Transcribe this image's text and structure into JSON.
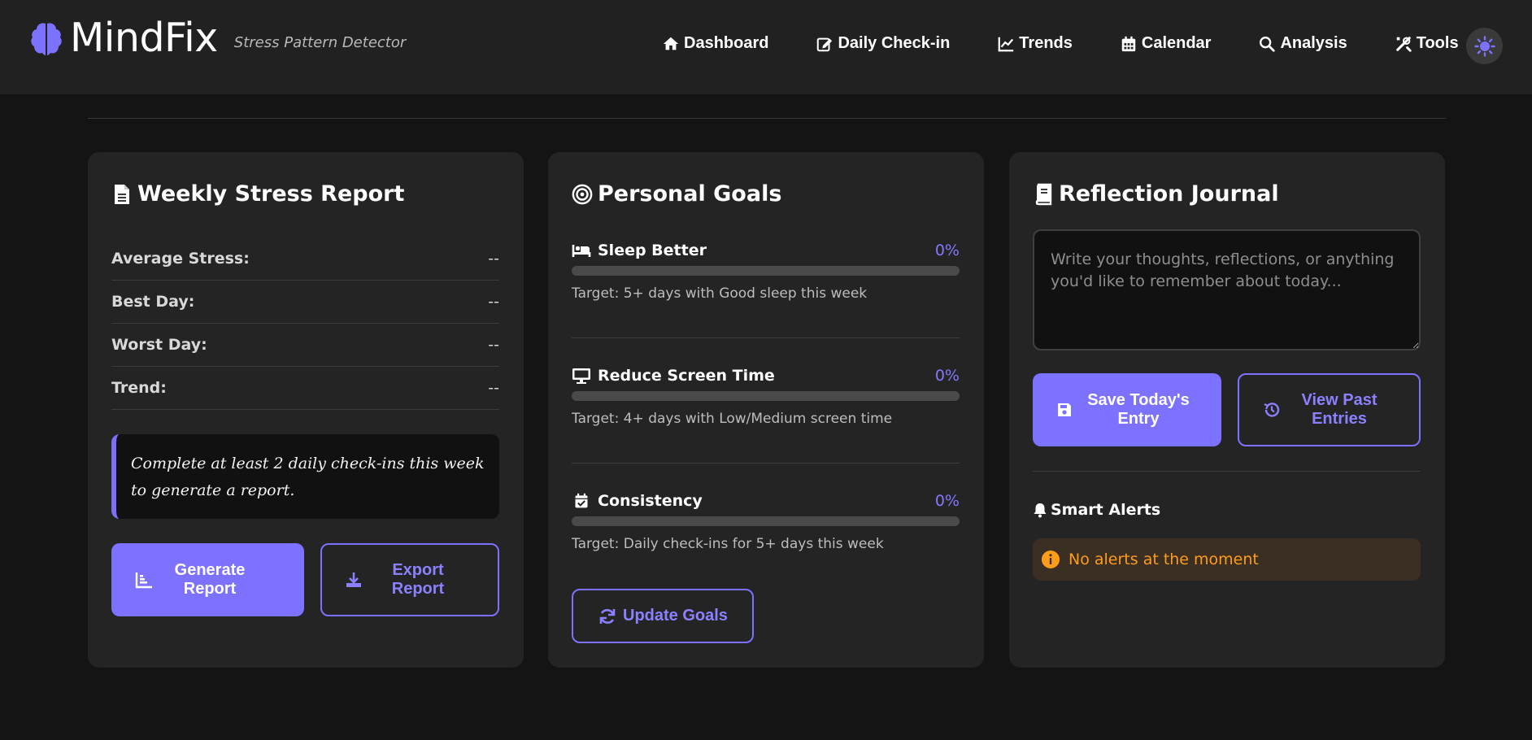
{
  "app": {
    "name": "MindFix",
    "tagline": "Stress Pattern Detector"
  },
  "nav": {
    "items": [
      {
        "label": "Dashboard",
        "icon": "home-icon"
      },
      {
        "label": "Daily Check-in",
        "icon": "edit-icon"
      },
      {
        "label": "Trends",
        "icon": "line-chart-icon"
      },
      {
        "label": "Calendar",
        "icon": "calendar-icon"
      },
      {
        "label": "Analysis",
        "icon": "search-icon"
      },
      {
        "label": "Tools",
        "icon": "tools-icon"
      }
    ],
    "theme_toggle_icon": "sun-icon"
  },
  "weekly_report": {
    "title": "Weekly Stress Report",
    "stats": [
      {
        "label": "Average Stress:",
        "value": "--"
      },
      {
        "label": "Best Day:",
        "value": "--"
      },
      {
        "label": "Worst Day:",
        "value": "--"
      },
      {
        "label": "Trend:",
        "value": "--"
      }
    ],
    "notice": "Complete at least 2 daily check-ins this week to generate a report.",
    "generate_label": "Generate Report",
    "export_label": "Export Report"
  },
  "goals": {
    "title": "Personal Goals",
    "items": [
      {
        "name": "Sleep Better",
        "percent": "0%",
        "progress": 0,
        "target": "Target: 5+ days with Good sleep this week",
        "icon": "bed-icon"
      },
      {
        "name": "Reduce Screen Time",
        "percent": "0%",
        "progress": 0,
        "target": "Target: 4+ days with Low/Medium screen time",
        "icon": "desktop-icon"
      },
      {
        "name": "Consistency",
        "percent": "0%",
        "progress": 0,
        "target": "Target: Daily check-ins for 5+ days this week",
        "icon": "calendar-check-icon"
      }
    ],
    "update_label": "Update Goals"
  },
  "journal": {
    "title": "Reflection Journal",
    "value": "",
    "placeholder": "Write your thoughts, reflections, or anything you'd like to remember about today...",
    "save_label": "Save Today's Entry",
    "view_label": "View Past Entries"
  },
  "alerts": {
    "title": "Smart Alerts",
    "message": "No alerts at the moment"
  },
  "colors": {
    "accent": "#7c72ff",
    "background": "#141414",
    "card": "#242424",
    "navbar": "#212121",
    "alert_text": "#ff9d1a",
    "alert_bg": "#3b2e22"
  }
}
